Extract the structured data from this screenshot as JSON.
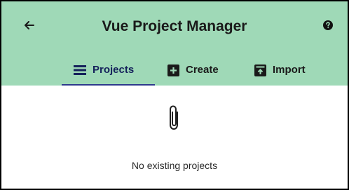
{
  "app": {
    "title": "Vue Project Manager"
  },
  "header": {
    "back_icon": "arrow-left-icon",
    "help_icon": "help-circle-icon",
    "background_color": "#9fd9b7"
  },
  "tabs": [
    {
      "label": "Projects",
      "icon": "list-icon",
      "active": true
    },
    {
      "label": "Create",
      "icon": "plus-box-icon",
      "active": false
    },
    {
      "label": "Import",
      "icon": "import-box-icon",
      "active": false
    }
  ],
  "accent_color": "#2d3a8c",
  "empty_state": {
    "icon": "paperclip-icon",
    "message": "No existing projects"
  }
}
